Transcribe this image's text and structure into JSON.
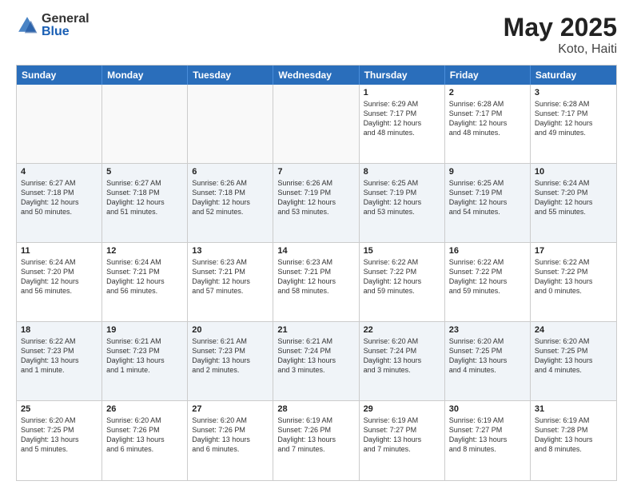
{
  "header": {
    "logo_general": "General",
    "logo_blue": "Blue",
    "title": "May 2025",
    "location": "Koto, Haiti"
  },
  "days_of_week": [
    "Sunday",
    "Monday",
    "Tuesday",
    "Wednesday",
    "Thursday",
    "Friday",
    "Saturday"
  ],
  "weeks": [
    [
      {
        "day": "",
        "info": "",
        "empty": true
      },
      {
        "day": "",
        "info": "",
        "empty": true
      },
      {
        "day": "",
        "info": "",
        "empty": true
      },
      {
        "day": "",
        "info": "",
        "empty": true
      },
      {
        "day": "1",
        "info": "Sunrise: 6:29 AM\nSunset: 7:17 PM\nDaylight: 12 hours\nand 48 minutes."
      },
      {
        "day": "2",
        "info": "Sunrise: 6:28 AM\nSunset: 7:17 PM\nDaylight: 12 hours\nand 48 minutes."
      },
      {
        "day": "3",
        "info": "Sunrise: 6:28 AM\nSunset: 7:17 PM\nDaylight: 12 hours\nand 49 minutes."
      }
    ],
    [
      {
        "day": "4",
        "info": "Sunrise: 6:27 AM\nSunset: 7:18 PM\nDaylight: 12 hours\nand 50 minutes."
      },
      {
        "day": "5",
        "info": "Sunrise: 6:27 AM\nSunset: 7:18 PM\nDaylight: 12 hours\nand 51 minutes."
      },
      {
        "day": "6",
        "info": "Sunrise: 6:26 AM\nSunset: 7:18 PM\nDaylight: 12 hours\nand 52 minutes."
      },
      {
        "day": "7",
        "info": "Sunrise: 6:26 AM\nSunset: 7:19 PM\nDaylight: 12 hours\nand 53 minutes."
      },
      {
        "day": "8",
        "info": "Sunrise: 6:25 AM\nSunset: 7:19 PM\nDaylight: 12 hours\nand 53 minutes."
      },
      {
        "day": "9",
        "info": "Sunrise: 6:25 AM\nSunset: 7:19 PM\nDaylight: 12 hours\nand 54 minutes."
      },
      {
        "day": "10",
        "info": "Sunrise: 6:24 AM\nSunset: 7:20 PM\nDaylight: 12 hours\nand 55 minutes."
      }
    ],
    [
      {
        "day": "11",
        "info": "Sunrise: 6:24 AM\nSunset: 7:20 PM\nDaylight: 12 hours\nand 56 minutes."
      },
      {
        "day": "12",
        "info": "Sunrise: 6:24 AM\nSunset: 7:21 PM\nDaylight: 12 hours\nand 56 minutes."
      },
      {
        "day": "13",
        "info": "Sunrise: 6:23 AM\nSunset: 7:21 PM\nDaylight: 12 hours\nand 57 minutes."
      },
      {
        "day": "14",
        "info": "Sunrise: 6:23 AM\nSunset: 7:21 PM\nDaylight: 12 hours\nand 58 minutes."
      },
      {
        "day": "15",
        "info": "Sunrise: 6:22 AM\nSunset: 7:22 PM\nDaylight: 12 hours\nand 59 minutes."
      },
      {
        "day": "16",
        "info": "Sunrise: 6:22 AM\nSunset: 7:22 PM\nDaylight: 12 hours\nand 59 minutes."
      },
      {
        "day": "17",
        "info": "Sunrise: 6:22 AM\nSunset: 7:22 PM\nDaylight: 13 hours\nand 0 minutes."
      }
    ],
    [
      {
        "day": "18",
        "info": "Sunrise: 6:22 AM\nSunset: 7:23 PM\nDaylight: 13 hours\nand 1 minute."
      },
      {
        "day": "19",
        "info": "Sunrise: 6:21 AM\nSunset: 7:23 PM\nDaylight: 13 hours\nand 1 minute."
      },
      {
        "day": "20",
        "info": "Sunrise: 6:21 AM\nSunset: 7:23 PM\nDaylight: 13 hours\nand 2 minutes."
      },
      {
        "day": "21",
        "info": "Sunrise: 6:21 AM\nSunset: 7:24 PM\nDaylight: 13 hours\nand 3 minutes."
      },
      {
        "day": "22",
        "info": "Sunrise: 6:20 AM\nSunset: 7:24 PM\nDaylight: 13 hours\nand 3 minutes."
      },
      {
        "day": "23",
        "info": "Sunrise: 6:20 AM\nSunset: 7:25 PM\nDaylight: 13 hours\nand 4 minutes."
      },
      {
        "day": "24",
        "info": "Sunrise: 6:20 AM\nSunset: 7:25 PM\nDaylight: 13 hours\nand 4 minutes."
      }
    ],
    [
      {
        "day": "25",
        "info": "Sunrise: 6:20 AM\nSunset: 7:25 PM\nDaylight: 13 hours\nand 5 minutes."
      },
      {
        "day": "26",
        "info": "Sunrise: 6:20 AM\nSunset: 7:26 PM\nDaylight: 13 hours\nand 6 minutes."
      },
      {
        "day": "27",
        "info": "Sunrise: 6:20 AM\nSunset: 7:26 PM\nDaylight: 13 hours\nand 6 minutes."
      },
      {
        "day": "28",
        "info": "Sunrise: 6:19 AM\nSunset: 7:26 PM\nDaylight: 13 hours\nand 7 minutes."
      },
      {
        "day": "29",
        "info": "Sunrise: 6:19 AM\nSunset: 7:27 PM\nDaylight: 13 hours\nand 7 minutes."
      },
      {
        "day": "30",
        "info": "Sunrise: 6:19 AM\nSunset: 7:27 PM\nDaylight: 13 hours\nand 8 minutes."
      },
      {
        "day": "31",
        "info": "Sunrise: 6:19 AM\nSunset: 7:28 PM\nDaylight: 13 hours\nand 8 minutes."
      }
    ]
  ]
}
